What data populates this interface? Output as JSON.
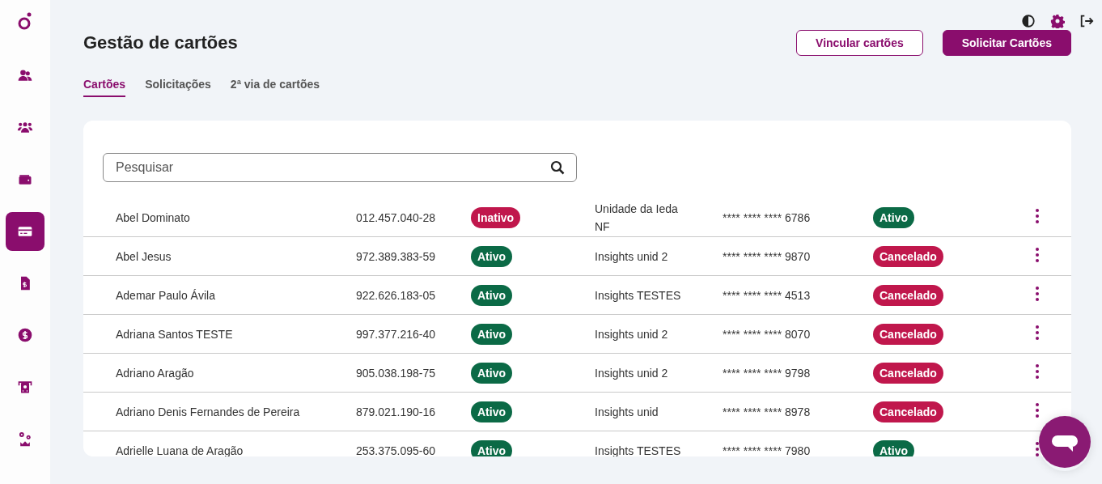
{
  "sidebar": {
    "items": [
      {
        "kind": "people",
        "selected": false
      },
      {
        "kind": "group",
        "selected": false
      },
      {
        "kind": "wallet",
        "selected": false
      },
      {
        "kind": "card",
        "selected": true
      },
      {
        "kind": "invoice",
        "selected": false
      },
      {
        "kind": "coin",
        "selected": false
      },
      {
        "kind": "atm",
        "selected": false
      },
      {
        "kind": "gears",
        "selected": false
      }
    ]
  },
  "header": {
    "title": "Gestão de cartões",
    "buttons": [
      {
        "label": "Vincular cartões",
        "kind": "outline"
      },
      {
        "label": "Solicitar Cartões",
        "kind": "primary"
      }
    ]
  },
  "tabs": [
    {
      "label": "Cartões",
      "selected": true
    },
    {
      "label": "Solicitações",
      "selected": false
    },
    {
      "label": "2ª via de cartões",
      "selected": false
    }
  ],
  "search": {
    "placeholder": "Pesquisar"
  },
  "table": {
    "rows": [
      {
        "name": "Abel Dominato",
        "cpf": "012.457.040-28",
        "status": {
          "label": "Inativo",
          "color": "#c0174c"
        },
        "unit": "Unidade da Ieda NF",
        "card": "**** **** **** 6786",
        "card_status": {
          "label": "Ativo",
          "color": "#0b6a46"
        }
      },
      {
        "name": "Abel Jesus",
        "cpf": "972.389.383-59",
        "status": {
          "label": "Ativo",
          "color": "#0b6a46"
        },
        "unit": "Insights unid 2",
        "card": "**** **** **** 9870",
        "card_status": {
          "label": "Cancelado",
          "color": "#c0174c"
        }
      },
      {
        "name": "Ademar Paulo Ávila",
        "cpf": "922.626.183-05",
        "status": {
          "label": "Ativo",
          "color": "#0b6a46"
        },
        "unit": "Insights TESTES",
        "card": "**** **** **** 4513",
        "card_status": {
          "label": "Cancelado",
          "color": "#c0174c"
        }
      },
      {
        "name": "Adriana Santos TESTE",
        "cpf": "997.377.216-40",
        "status": {
          "label": "Ativo",
          "color": "#0b6a46"
        },
        "unit": "Insights unid 2",
        "card": "**** **** **** 8070",
        "card_status": {
          "label": "Cancelado",
          "color": "#c0174c"
        }
      },
      {
        "name": "Adriano Aragão",
        "cpf": "905.038.198-75",
        "status": {
          "label": "Ativo",
          "color": "#0b6a46"
        },
        "unit": "Insights unid 2",
        "card": "**** **** **** 9798",
        "card_status": {
          "label": "Cancelado",
          "color": "#c0174c"
        }
      },
      {
        "name": "Adriano Denis Fernandes de Pereira",
        "cpf": "879.021.190-16",
        "status": {
          "label": "Ativo",
          "color": "#0b6a46"
        },
        "unit": "Insights unid",
        "card": "**** **** **** 8978",
        "card_status": {
          "label": "Cancelado",
          "color": "#c0174c"
        }
      },
      {
        "name": "Adrielle Luana de Aragão",
        "cpf": "253.375.095-60",
        "status": {
          "label": "Ativo",
          "color": "#0b6a46"
        },
        "unit": "Insights TESTES",
        "card": "**** **** **** 7980",
        "card_status": {
          "label": "Ativo",
          "color": "#0b6a46"
        }
      }
    ]
  }
}
